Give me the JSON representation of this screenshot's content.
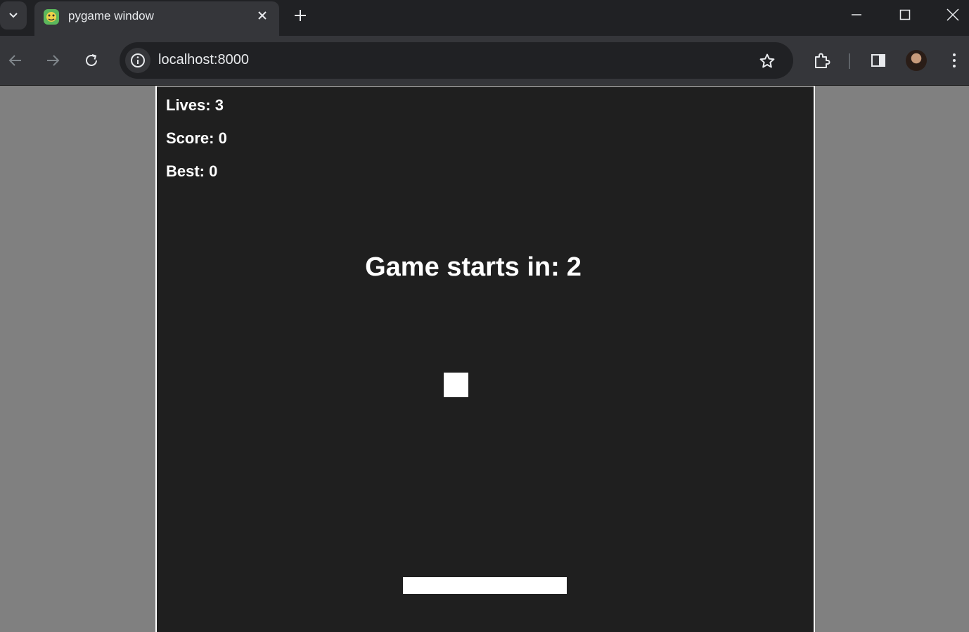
{
  "browser": {
    "tab": {
      "title": "pygame window"
    },
    "address_bar": {
      "url": "localhost:8000"
    }
  },
  "game": {
    "lives_label": "Lives:",
    "lives": "3",
    "score_label": "Score:",
    "score": "0",
    "best_label": "Best:",
    "best": "0",
    "countdown_label": "Game starts in:",
    "countdown": "2"
  },
  "colors": {
    "browser_frame": "#202124",
    "toolbar": "#35363a",
    "page_background": "#808080",
    "game_background": "#1f1f1f",
    "game_foreground": "#ffffff"
  }
}
